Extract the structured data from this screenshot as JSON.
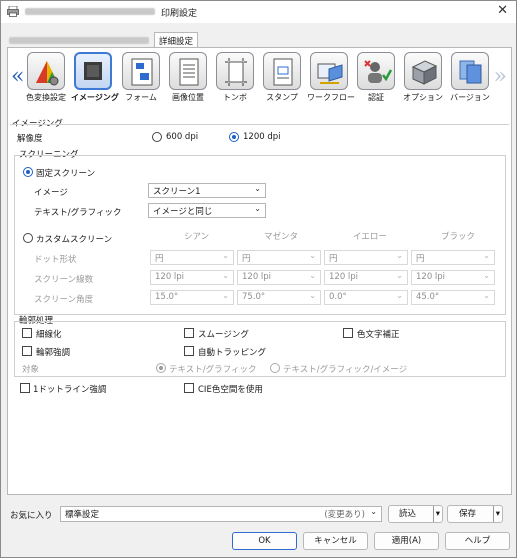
{
  "window": {
    "title": "印刷設定",
    "close_glyph": "✕"
  },
  "tabs": [
    {
      "label": "詳細設定"
    }
  ],
  "iconbar": {
    "left_arrow": "«",
    "right_arrow": "»",
    "items": [
      {
        "label": "色変換設定",
        "icon": "color-convert-icon"
      },
      {
        "label": "イメージング",
        "icon": "imaging-icon"
      },
      {
        "label": "フォーム",
        "icon": "form-icon"
      },
      {
        "label": "画像位置",
        "icon": "image-position-icon"
      },
      {
        "label": "トンボ",
        "icon": "crop-marks-icon"
      },
      {
        "label": "スタンプ",
        "icon": "stamp-icon"
      },
      {
        "label": "ワークフロー",
        "icon": "workflow-icon"
      },
      {
        "label": "認証",
        "icon": "authentication-icon"
      },
      {
        "label": "オプション",
        "icon": "options-icon"
      },
      {
        "label": "バージョン",
        "icon": "version-icon"
      }
    ]
  },
  "imaging": {
    "section_title": "イメージング",
    "resolution_label": "解像度",
    "res_600": "600 dpi",
    "res_1200": "1200 dpi"
  },
  "screening": {
    "title": "スクリーニング",
    "fixed_label": "固定スクリーン",
    "image_label": "イメージ",
    "image_value": "スクリーン1",
    "text_label": "テキスト/グラフィック",
    "text_value": "イメージと同じ",
    "custom_label": "カスタムスクリーン",
    "columns": [
      "シアン",
      "マゼンタ",
      "イエロー",
      "ブラック"
    ],
    "rows": [
      {
        "label": "ドット形状",
        "values": [
          "円",
          "円",
          "円",
          "円"
        ]
      },
      {
        "label": "スクリーン線数",
        "values": [
          "120 lpi",
          "120 lpi",
          "120 lpi",
          "120 lpi"
        ]
      },
      {
        "label": "スクリーン角度",
        "values": [
          "15.0°",
          "75.0°",
          "0.0°",
          "45.0°"
        ]
      }
    ]
  },
  "outline": {
    "title": "輪郭処理",
    "thin_line": "細線化",
    "smoothing": "スムージング",
    "color_char": "色文字補正",
    "edge_enhance": "輪郭強調",
    "auto_trapping": "自動トラッピング",
    "target_label": "対象",
    "target_text_graphic": "テキスト/グラフィック",
    "target_text_graphic_image": "テキスト/グラフィック/イメージ"
  },
  "extra": {
    "one_dot_line": "1ドットライン強調",
    "cie_color": "CIE色空間を使用"
  },
  "favorites": {
    "label": "お気に入り",
    "value": "標準設定",
    "modified": "(変更あり)",
    "load": "読込",
    "save": "保存"
  },
  "buttons": {
    "ok": "OK",
    "cancel": "キャンセル",
    "apply": "適用(A)",
    "help": "ヘルプ"
  }
}
